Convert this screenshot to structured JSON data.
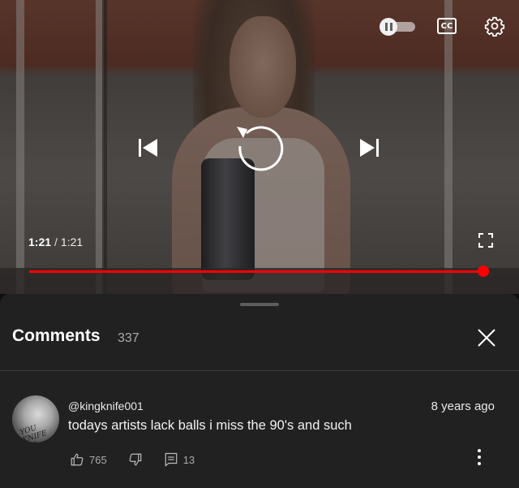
{
  "player": {
    "current_time": "1:21",
    "separator": "/",
    "duration": "1:21",
    "progress_fraction": 1.0,
    "autoplay_state": "paused",
    "cc_label": "CC",
    "accent_color": "#ff0000"
  },
  "comments_panel": {
    "title": "Comments",
    "count": "337",
    "comments": [
      {
        "author": "@kingknife001",
        "time": "8 years ago",
        "text": "todays artists lack balls i miss the 90's and such",
        "likes": "765",
        "replies": "13",
        "avatar_text": "YOU KNIFE ME"
      }
    ]
  },
  "icons": {
    "autoplay": "autoplay-toggle-icon",
    "captions": "closed-captions-icon",
    "settings": "gear-icon",
    "previous": "skip-previous-icon",
    "replay": "replay-icon",
    "next": "skip-next-icon",
    "fullscreen": "fullscreen-icon",
    "close": "close-icon",
    "like": "thumbs-up-icon",
    "dislike": "thumbs-down-icon",
    "reply": "reply-icon",
    "more": "more-vertical-icon"
  }
}
